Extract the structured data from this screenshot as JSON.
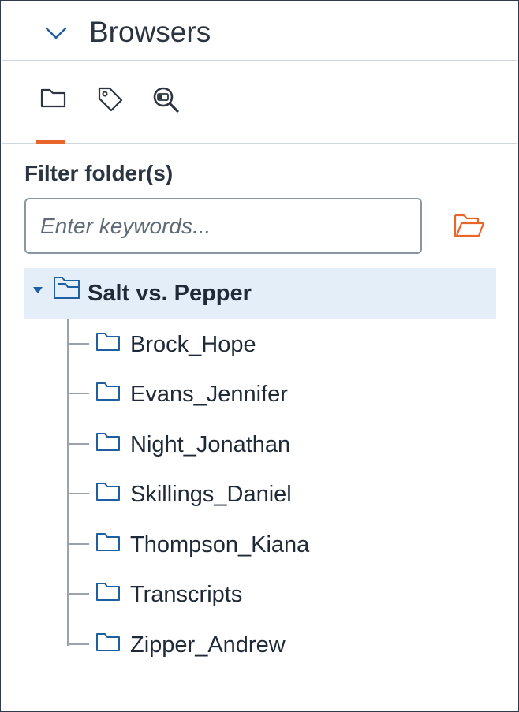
{
  "header": {
    "title": "Browsers",
    "collapse_icon": "chevron-down-icon"
  },
  "tabs": [
    {
      "name": "folders",
      "icon": "folder-icon",
      "active": true
    },
    {
      "name": "tags",
      "icon": "tag-icon",
      "active": false
    },
    {
      "name": "search",
      "icon": "search-icon",
      "active": false
    }
  ],
  "filter": {
    "label": "Filter folder(s)",
    "placeholder": "Enter keywords...",
    "value": "",
    "open_folder_icon": "open-folder-icon"
  },
  "tree": {
    "root": {
      "label": "Salt vs. Pepper",
      "expanded": true
    },
    "children": [
      {
        "label": "Brock_Hope"
      },
      {
        "label": "Evans_Jennifer"
      },
      {
        "label": "Night_Jonathan"
      },
      {
        "label": "Skillings_Daniel"
      },
      {
        "label": "Thompson_Kiana"
      },
      {
        "label": "Transcripts"
      },
      {
        "label": "Zipper_Andrew"
      }
    ]
  },
  "colors": {
    "accent": "#e8662a",
    "icon_blue": "#1d5fa0",
    "selected_bg": "#e3eef9",
    "text": "#1f2937"
  }
}
